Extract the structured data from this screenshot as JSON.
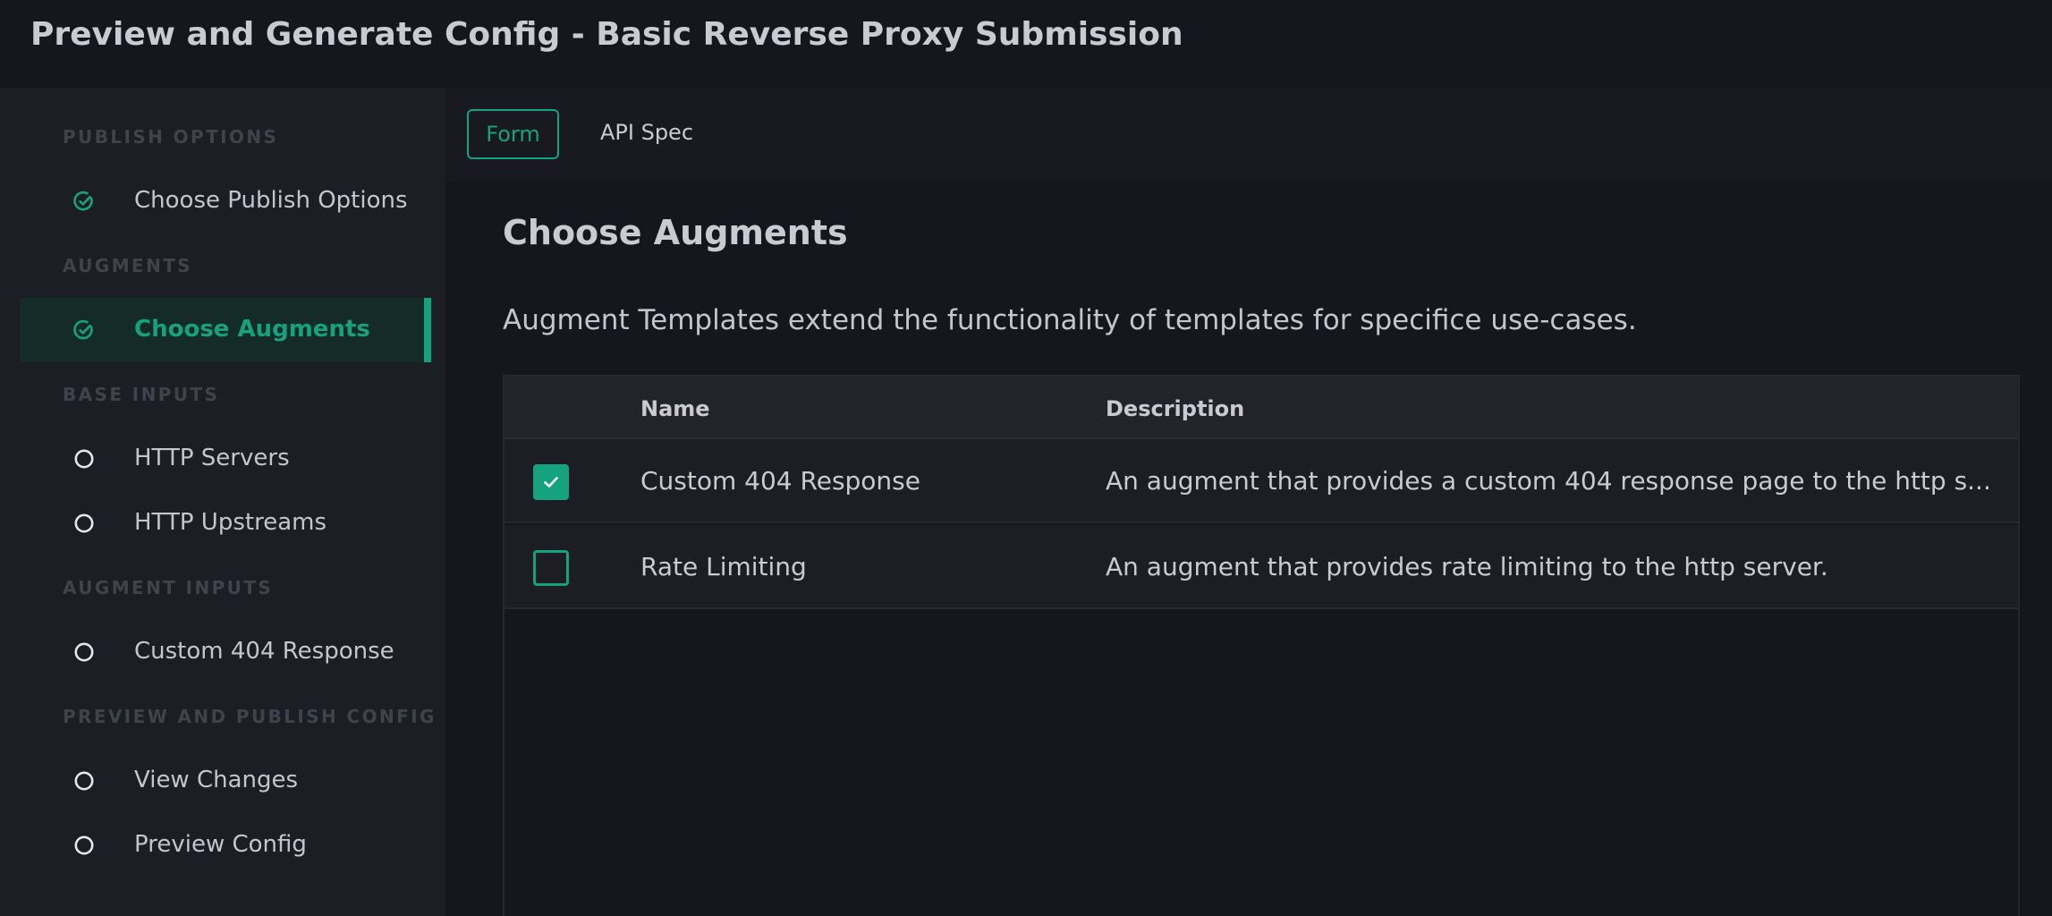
{
  "header": {
    "title": "Preview and Generate Config - Basic Reverse Proxy Submission"
  },
  "sidebar": {
    "sections": [
      {
        "label": "PUBLISH OPTIONS",
        "items": [
          {
            "label": "Choose Publish Options",
            "icon": "check-circle-icon",
            "status": "complete"
          }
        ]
      },
      {
        "label": "AUGMENTS",
        "items": [
          {
            "label": "Choose Augments",
            "icon": "check-circle-icon",
            "status": "active"
          }
        ]
      },
      {
        "label": "BASE INPUTS",
        "items": [
          {
            "label": "HTTP Servers",
            "icon": "circle-icon",
            "status": "pending"
          },
          {
            "label": "HTTP Upstreams",
            "icon": "circle-icon",
            "status": "pending"
          }
        ]
      },
      {
        "label": "AUGMENT INPUTS",
        "items": [
          {
            "label": "Custom 404 Response",
            "icon": "circle-icon",
            "status": "pending"
          }
        ]
      },
      {
        "label": "PREVIEW AND PUBLISH CONFIG",
        "items": [
          {
            "label": "View Changes",
            "icon": "circle-icon",
            "status": "pending"
          },
          {
            "label": "Preview Config",
            "icon": "circle-icon",
            "status": "pending"
          }
        ]
      }
    ]
  },
  "tabs": [
    {
      "label": "Form",
      "selected": true
    },
    {
      "label": "API Spec",
      "selected": false
    }
  ],
  "main": {
    "title": "Choose Augments",
    "description": "Augment Templates extend the functionality of templates for specifice use-cases.",
    "table": {
      "columns": [
        "Name",
        "Description"
      ],
      "rows": [
        {
          "checked": true,
          "name": "Custom 404 Response",
          "description": "An augment that provides a custom 404 response page to the http s..."
        },
        {
          "checked": false,
          "name": "Rate Limiting",
          "description": "An augment that provides rate limiting to the http server."
        }
      ]
    }
  },
  "colors": {
    "accent": "#14a37e",
    "background": "#16171e",
    "sidebar": "#1c1e25"
  }
}
